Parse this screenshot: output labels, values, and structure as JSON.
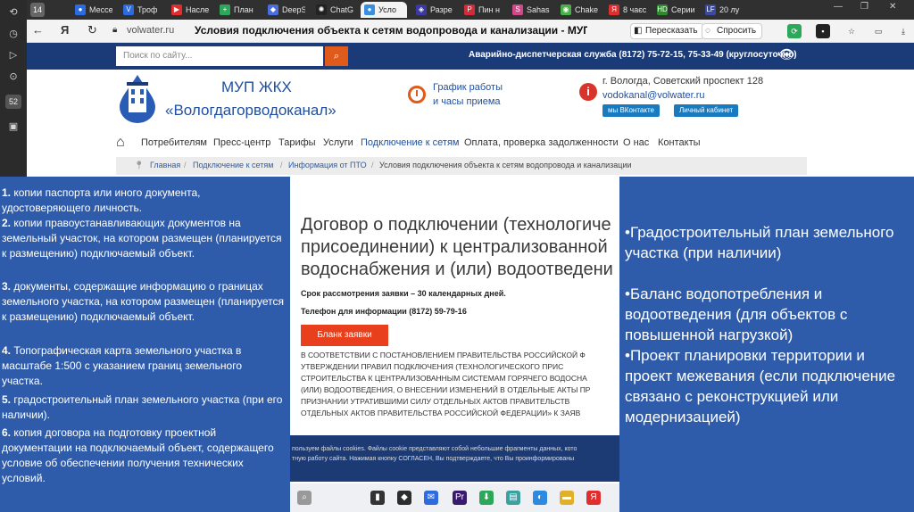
{
  "browser": {
    "tab_count": "14",
    "tabs": [
      {
        "label": "Мессе",
        "icon": "messenger-icon",
        "color": "#2d6be0"
      },
      {
        "label": "Троф",
        "icon": "vk-icon",
        "color": "#2d6be0"
      },
      {
        "label": "Насле",
        "icon": "youtube-icon",
        "color": "#e02d2d"
      },
      {
        "label": "План",
        "icon": "plus-icon",
        "color": "#2da85a"
      },
      {
        "label": "DeepS",
        "icon": "deepseek-icon",
        "color": "#4a6ee0"
      },
      {
        "label": "ChatG",
        "icon": "chatgpt-icon",
        "color": "#222222"
      },
      {
        "label": "Усло",
        "icon": "water-drop-icon",
        "color": "#3a8ee0"
      },
      {
        "label": "Разре",
        "icon": "logo-icon",
        "color": "#3a3aa0"
      },
      {
        "label": "Пин н",
        "icon": "pinterest-icon",
        "color": "#d02d3a"
      },
      {
        "label": "Sahas",
        "icon": "sahas-icon",
        "color": "#d04a8a"
      },
      {
        "label": "Chake",
        "icon": "chrome-icon",
        "color": "#4ab04a"
      },
      {
        "label": "8 чаєс",
        "icon": "yandex-icon",
        "color": "#e02d2d"
      },
      {
        "label": "Серии",
        "icon": "hd-icon",
        "color": "#2d8a2d"
      },
      {
        "label": "20 лу",
        "icon": "lf-icon",
        "color": "#3a4aa0"
      }
    ],
    "url_domain": "volwater.ru",
    "page_title": "Условия подключения объекта к сетям водопровода и канализации - МУП ЖКХ \"Вол...",
    "translate_label": "Пересказать",
    "ask_label": "Спросить"
  },
  "site": {
    "search_placeholder": "Поиск по сайту...",
    "dispatch": "Аварийно-диспетчерская служба (8172) 75-72-15, 75-33-49 (круглосуточно)",
    "brand_line1": "МУП ЖКХ",
    "brand_line2": "«Вологдагорводоканал»",
    "schedule_line1": "График работы",
    "schedule_line2": "и часы приема",
    "address": "г. Вологда, Советский проспект 128",
    "email": "vodokanal@volwater.ru",
    "vk_button": "мы ВКонтакте",
    "cabinet_button": "Личный кабинет",
    "nav": [
      "Потребителям",
      "Пресс-центр",
      "Тарифы",
      "Услуги",
      "Подключение к сетям",
      "Оплата, проверка задолженности",
      "О нас",
      "Контакты"
    ],
    "breadcrumbs": [
      "Главная",
      "Подключение к сетям",
      "Информация от ПТО",
      "Условия подключения объекта к сетям водопровода и канализации"
    ]
  },
  "document": {
    "title_lines": [
      "Договор о подключении (технологиче",
      "присоединении) к централизованной",
      "водоснабжения и (или) водоотведени"
    ],
    "review_period": "Срок рассмотрения заявки – 30 календарных дней.",
    "phone": "Телефон для информации (8172) 59-79-16",
    "form_button": "Бланк заявки",
    "legal_lines": [
      "В СООТВЕТСТВИИ С ПОСТАНОВЛЕНИЕМ ПРАВИТЕЛЬСТВА РОССИЙСКОЙ Ф",
      "УТВЕРЖДЕНИИ ПРАВИЛ ПОДКЛЮЧЕНИЯ (ТЕХНОЛОГИЧЕСКОГО ПРИС",
      "СТРОИТЕЛЬСТВА К ЦЕНТРАЛИЗОВАННЫМ СИСТЕМАМ ГОРЯЧЕГО ВОДОСНА",
      "(ИЛИ) ВОДООТВЕДЕНИЯ, О ВНЕСЕНИИ ИЗМЕНЕНИЙ В ОТДЕЛЬНЫЕ АКТЫ ПР",
      "ПРИЗНАНИИ УТРАТИВШИМИ СИЛУ ОТДЕЛЬНЫХ АКТОВ ПРАВИТЕЛЬСТВ",
      "ОТДЕЛЬНЫХ АКТОВ ПРАВИТЕЛЬСТВА РОССИЙСКОЙ ФЕДЕРАЦИИ» к заяв"
    ],
    "cookie_line1": "пользуем файлы cookies. Файлы cookie представляют собой небольшие фрагменты данных, кото",
    "cookie_line2": "тную работу сайта. Нажимая кнопку СОГЛАСЕН, Вы подтверждаете, что Вы проинформированы"
  },
  "left_list": [
    {
      "num": "1.",
      "text": " копии паспорта или иного документа, удостоверяющего личность."
    },
    {
      "num": "2.",
      "text": " копии правоустанавливающих документов на земельный участок, на котором размещен (планируется к размещению) подключаемый объект."
    },
    {
      "num": "3.",
      "text": " документы, содержащие информацию о границах земельного участка, на котором размещен (планируется к размещению) подключаемый объект."
    },
    {
      "num": "4.",
      "text": " Топографическая карта земельного участка в масштабе 1:500 с указанием границ земельного участка."
    },
    {
      "num": "5.",
      "text": " градостроительный план земельного участка (при его наличии)."
    },
    {
      "num": "6.",
      "text": " копия договора на подготовку проектной документации на подключаемый объект, содержащего условие об обеспечении получения технических условий."
    }
  ],
  "right_list": [
    "•Градостроительный план земельного участка (при наличии)",
    "•Баланс водопотребления и водоотведения (для объектов с повышенной нагрузкой)",
    "•Проект планировки территории и проект межевания (если подключение связано с реконструкцией или модернизацией)"
  ],
  "colors": {
    "panel": "#2f5caa",
    "site_header": "#1a3b78",
    "accent": "#e05a1a"
  }
}
